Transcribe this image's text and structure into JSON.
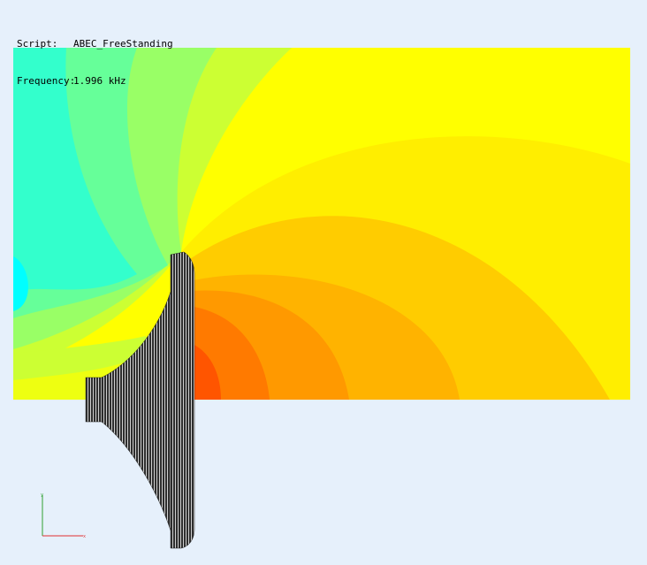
{
  "info": {
    "script_label": "Script:",
    "script_value": "ABEC_FreeStanding",
    "frequency_label": "Frequency:",
    "frequency_value": "1.996 kHz"
  },
  "axes": {
    "x_label": "x",
    "y_label": "y",
    "x_color": "#e03030",
    "y_color": "#30a030"
  },
  "colormap": {
    "background": "#e6f0fb",
    "field_bands": [
      "#00ffff",
      "#33ffcc",
      "#66ff99",
      "#99ff66",
      "#ccff33",
      "#eeff11",
      "#ffff00",
      "#ffdd00",
      "#ffbb00",
      "#ff9900",
      "#ff7700",
      "#ff5500"
    ],
    "horn_fill": "#3a3a3a",
    "horn_lines": "#cccccc"
  }
}
